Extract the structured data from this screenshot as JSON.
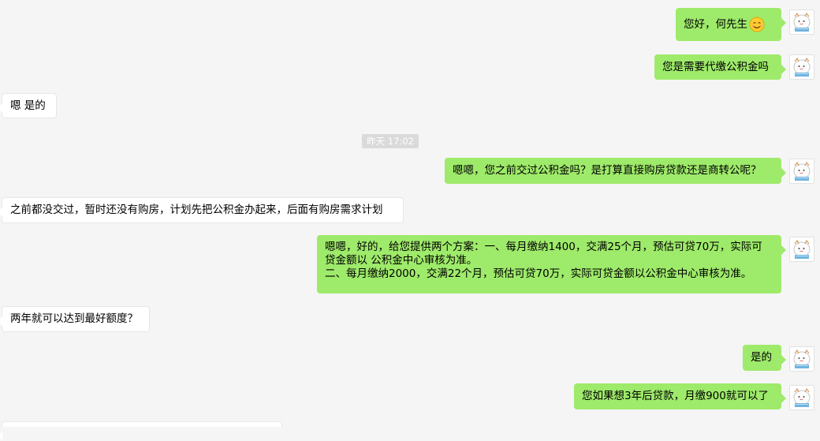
{
  "messages": [
    {
      "side": "out",
      "text": "您好，何先生"
    },
    {
      "side": "out",
      "text": "您是需要代缴公积金吗"
    },
    {
      "side": "in",
      "text": "嗯 是的"
    },
    {
      "side": "out",
      "text": "嗯嗯，您之前交过公积金吗？是打算直接购房贷款还是商转公呢？"
    },
    {
      "side": "in",
      "text": "之前都没交过，暂时还没有购房，计划先把公积金办起来，后面有购房需求计划"
    },
    {
      "side": "out",
      "lines": [
        "嗯嗯，好的，给您提供两个方案：一、每月缴纳1400，交满25个月，预估可贷70万，实际可",
        "贷金额以 公积金中心审核为准。",
        "二、每月缴纳2000，交满22个月，预估可贷70万，实际可贷金额以公积金中心审核为准。"
      ]
    },
    {
      "side": "in",
      "text": "两年就可以达到最好额度？"
    },
    {
      "side": "out",
      "text": "是的"
    },
    {
      "side": "out",
      "text": "您如果想3年后贷款，月缴900就可以了"
    }
  ],
  "timestamp": "昨天 17:02",
  "emoji_icon": "smiling-face-emoji",
  "avatar_icon": "cartoon-character-avatar",
  "colors": {
    "background": "#f5f5f5",
    "outgoing_bubble": "#9eea6a",
    "incoming_bubble": "#ffffff",
    "timestamp_bg": "#dadada"
  }
}
